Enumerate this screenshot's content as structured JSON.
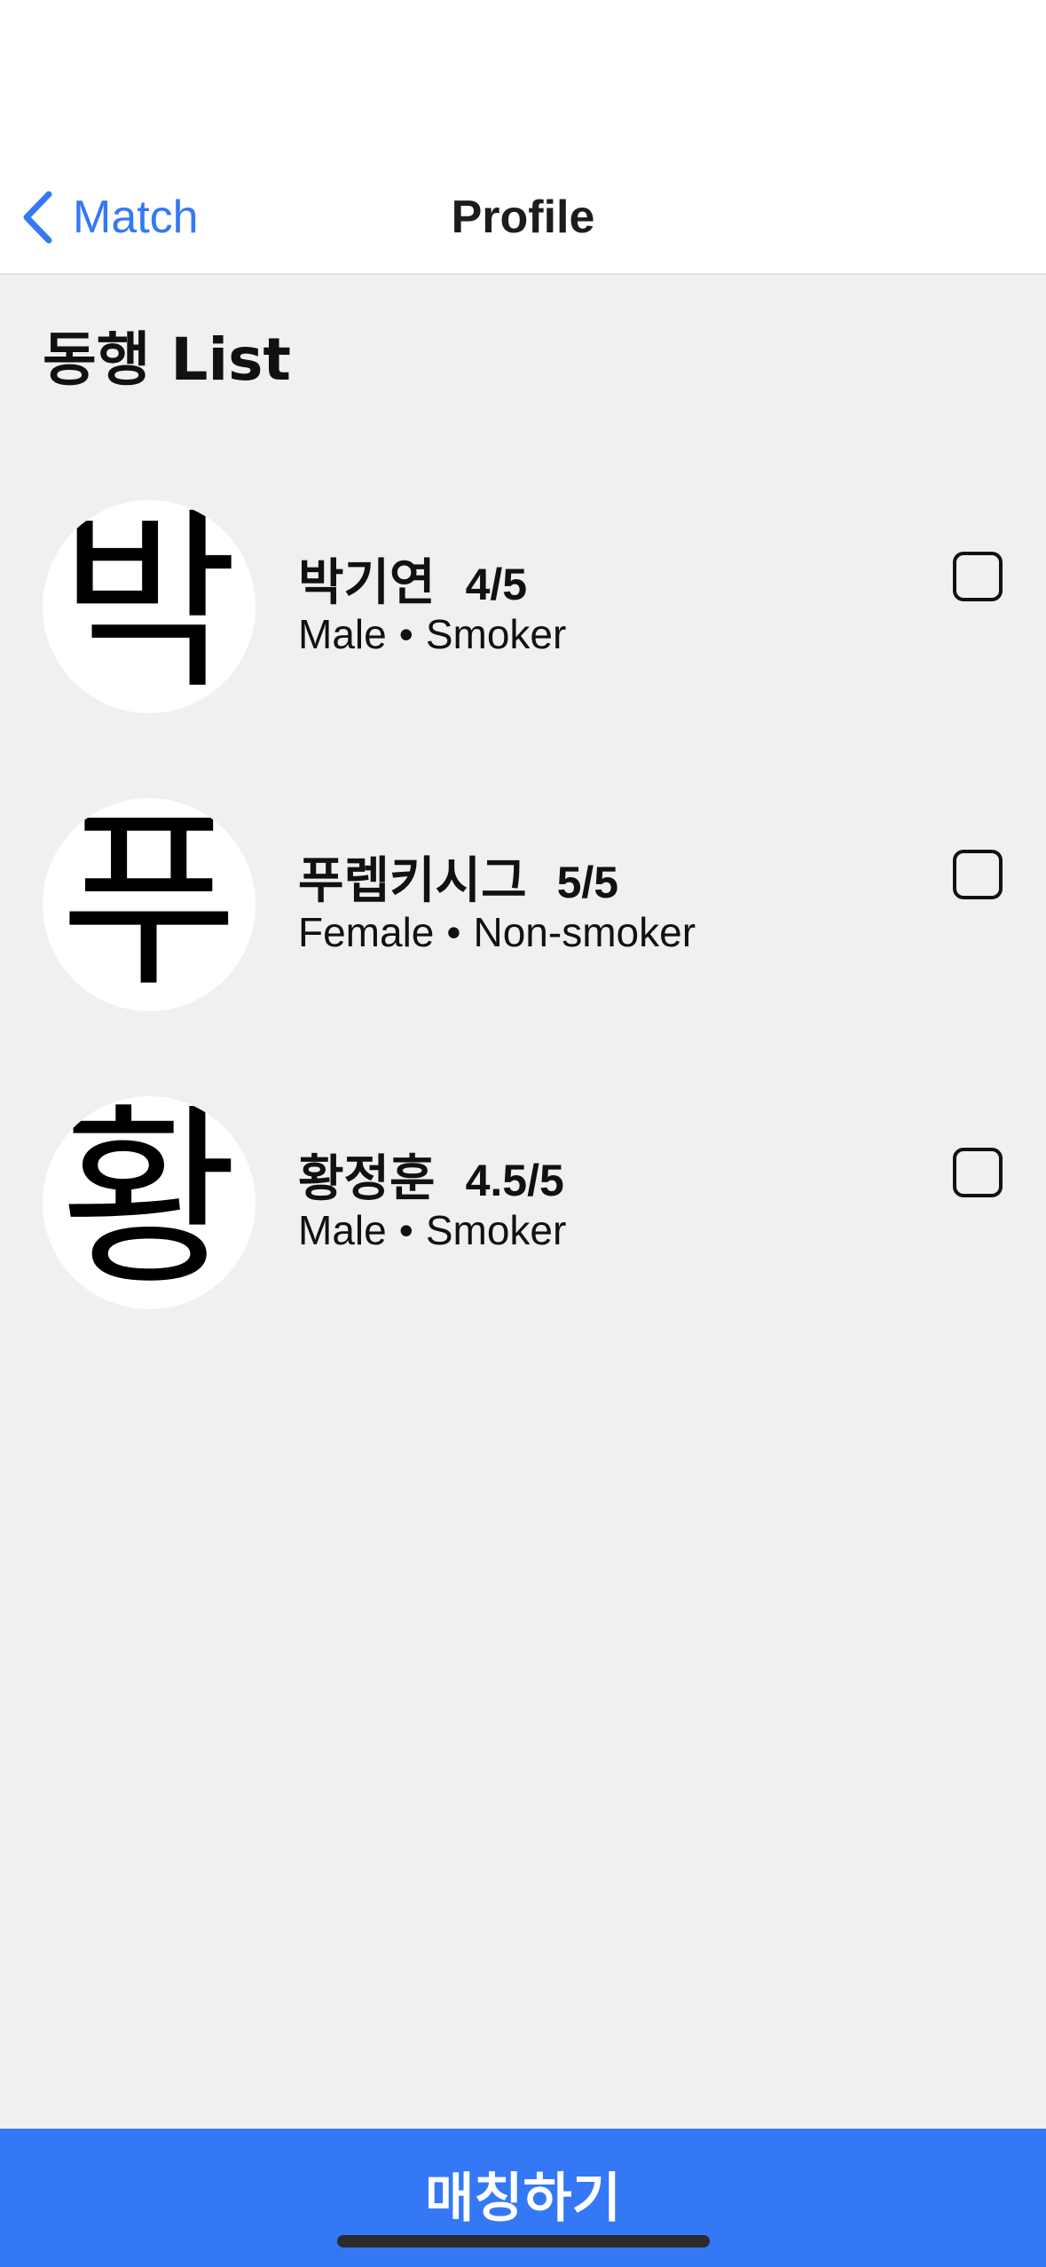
{
  "nav": {
    "back_label": "Match",
    "title": "Profile"
  },
  "heading": "동행 List",
  "companions": [
    {
      "initial": "박",
      "name": "박기연",
      "rating": "4/5",
      "gender": "Male",
      "separator": "•",
      "smoking": "Smoker",
      "checked": false
    },
    {
      "initial": "푸",
      "name": "푸렙키시그",
      "rating": "5/5",
      "gender": "Female",
      "separator": "•",
      "smoking": "Non-smoker",
      "checked": false
    },
    {
      "initial": "황",
      "name": "황정훈",
      "rating": "4.5/5",
      "gender": "Male",
      "separator": "•",
      "smoking": "Smoker",
      "checked": false
    }
  ],
  "action_button": {
    "label": "매칭하기"
  },
  "colors": {
    "accent": "#3478f6",
    "background": "#f0f0f0"
  }
}
